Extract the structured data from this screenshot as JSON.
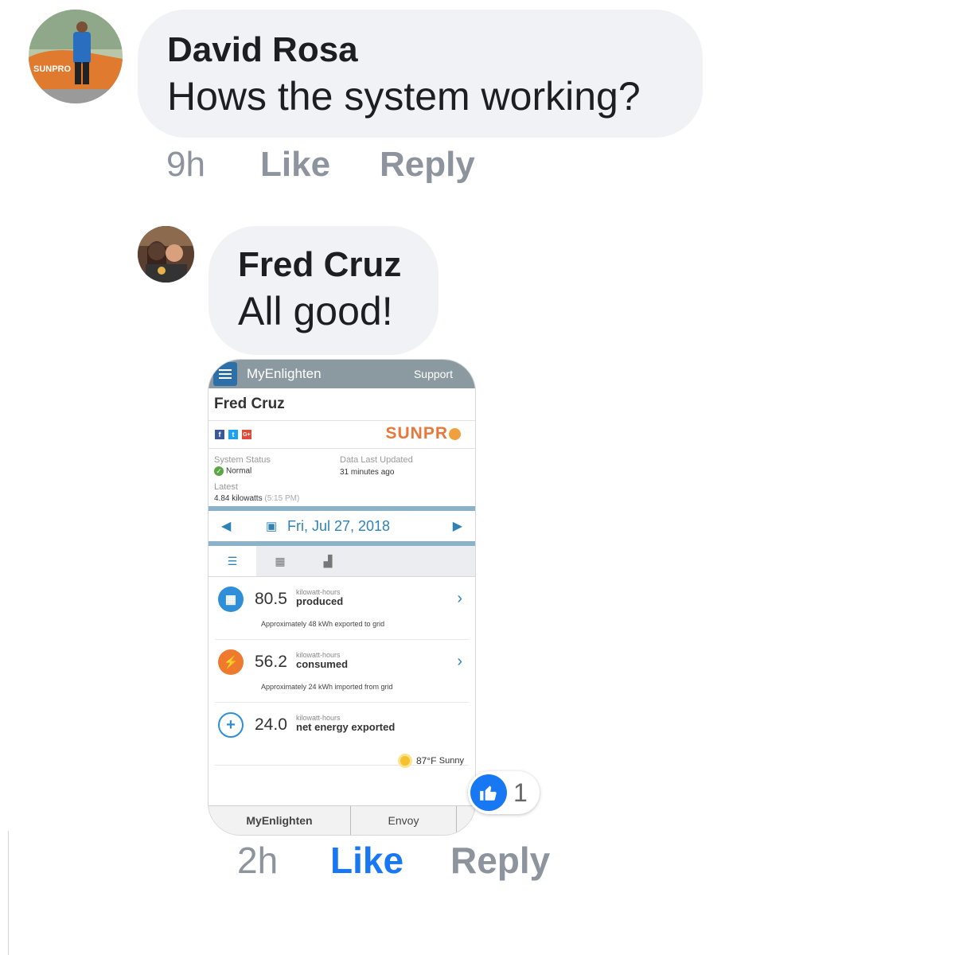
{
  "comments": [
    {
      "author": "David Rosa",
      "text": "Hows the system working?",
      "time": "9h",
      "like_label": "Like",
      "reply_label": "Reply",
      "avatar": "profile-photo"
    },
    {
      "author": "Fred Cruz",
      "text": "All good!",
      "time": "2h",
      "like_label": "Like",
      "reply_label": "Reply",
      "avatar": "profile-photo",
      "reaction": {
        "icon": "thumbs-up-icon",
        "count": "1",
        "color": "#1877f2"
      }
    }
  ],
  "attachment": {
    "app_title": "MyEnlighten",
    "support_label": "Support",
    "owner_name": "Fred Cruz",
    "brand": "SUNPR",
    "social": [
      "f",
      "t",
      "G+"
    ],
    "system_status_label": "System Status",
    "system_status_value": "Normal",
    "data_updated_label": "Data Last Updated",
    "data_updated_value": "31 minutes ago",
    "latest_label": "Latest",
    "latest_value": "4.84 kilowatts",
    "latest_time": "(5:15 PM)",
    "date": "Fri, Jul 27, 2018",
    "rows": [
      {
        "value": "80.5",
        "unit": "kilowatt-hours",
        "desc": "produced",
        "note": "Approximately 48 kWh exported to grid",
        "color": "#2e8fd8"
      },
      {
        "value": "56.2",
        "unit": "kilowatt-hours",
        "desc": "consumed",
        "note": "Approximately 24 kWh imported from grid",
        "color": "#ef7a2e"
      },
      {
        "value": "24.0",
        "unit": "kilowatt-hours",
        "desc": "net energy exported",
        "note": "",
        "color": "#2e8fd8"
      }
    ],
    "weather": {
      "temp": "87°F",
      "condition": "Sunny"
    },
    "bottom_tabs": [
      "MyEnlighten",
      "Envoy"
    ]
  }
}
